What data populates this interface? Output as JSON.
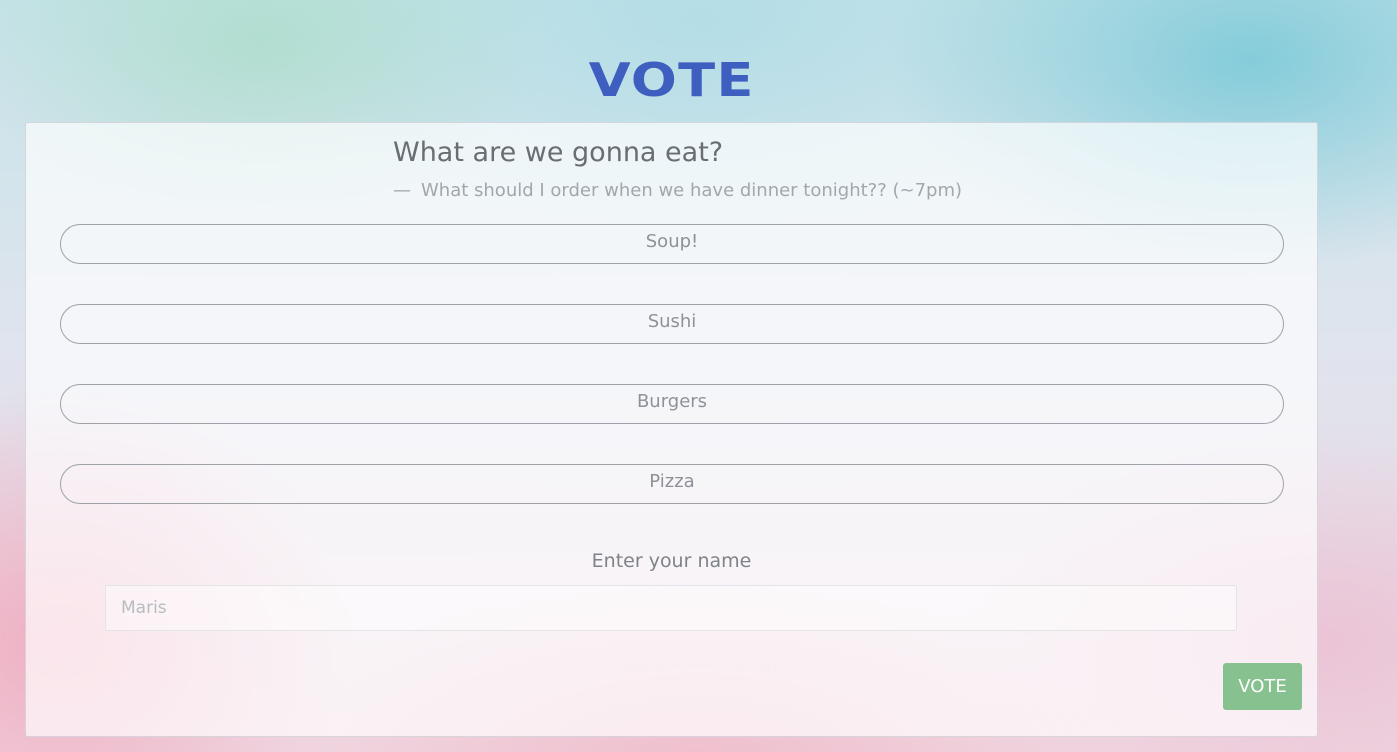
{
  "page": {
    "heading": "VOTE"
  },
  "poll": {
    "question": "What are we gonna eat?",
    "description_dash": "—",
    "description": "What should I order when we have dinner tonight?? (~7pm)",
    "options": [
      {
        "label": "Soup!"
      },
      {
        "label": "Sushi"
      },
      {
        "label": "Burgers"
      },
      {
        "label": "Pizza"
      }
    ]
  },
  "form": {
    "name_label": "Enter your name",
    "name_placeholder": "Maris",
    "submit_label": "VOTE"
  },
  "colors": {
    "heading": "#3f5fc0",
    "submit_button": "#86c18f"
  }
}
